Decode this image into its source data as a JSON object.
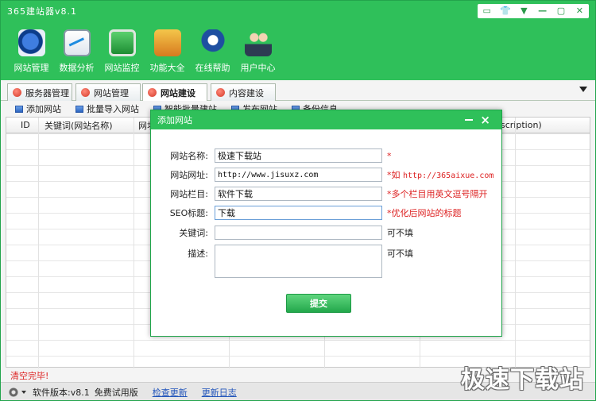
{
  "app": {
    "title": "365建站器v8.1"
  },
  "window_controls": [
    "▭",
    "👕",
    "▼",
    "—",
    "▢",
    "✕"
  ],
  "toolbar": [
    {
      "label": "网站管理",
      "icon": "site-manage-icon"
    },
    {
      "label": "数据分析",
      "icon": "data-analysis-icon"
    },
    {
      "label": "网站监控",
      "icon": "site-monitor-icon"
    },
    {
      "label": "功能大全",
      "icon": "functions-icon"
    },
    {
      "label": "在线帮助",
      "icon": "online-help-icon"
    },
    {
      "label": "用户中心",
      "icon": "user-center-icon"
    }
  ],
  "tabs": [
    {
      "label": "服务器管理",
      "active": false
    },
    {
      "label": "网站管理",
      "active": false
    },
    {
      "label": "网站建设",
      "active": true
    },
    {
      "label": "内容建设",
      "active": false
    }
  ],
  "subtools": [
    "添加网站",
    "批量导入网站",
    "智能批量建站",
    "发布网站",
    "备份信息"
  ],
  "grid": {
    "headers": [
      "ID",
      "关键词(网站名称)",
      "网址",
      "scription)"
    ]
  },
  "dialog": {
    "title": "添加网站",
    "fields": [
      {
        "label": "网站名称:",
        "value": "极速下载站",
        "note": "*",
        "note_mono": ""
      },
      {
        "label": "网站网址:",
        "value": "http://www.jisuxz.com",
        "note": "*如 ",
        "note_mono": "http://365aixue.com"
      },
      {
        "label": "网站栏目:",
        "value": "软件下载",
        "note": "*多个栏目用英文逗号隔开",
        "note_mono": ""
      },
      {
        "label": "SEO标题:",
        "value": "下载",
        "note": "*优化后网站的标题",
        "note_mono": ""
      },
      {
        "label": "关键词:",
        "value": "",
        "note": "可不填",
        "note_mono": ""
      },
      {
        "label": "描述:",
        "value": "",
        "note": "可不填",
        "note_mono": ""
      }
    ],
    "submit_label": "提交"
  },
  "status": {
    "message": "清空完毕!",
    "version": "软件版本:v8.1",
    "edition": "免费试用版",
    "check_update": "检查更新",
    "changelog": "更新日志"
  },
  "watermark": "极速下载站",
  "colors": {
    "accent": "#2fc05a",
    "note_red": "#dd2222"
  }
}
